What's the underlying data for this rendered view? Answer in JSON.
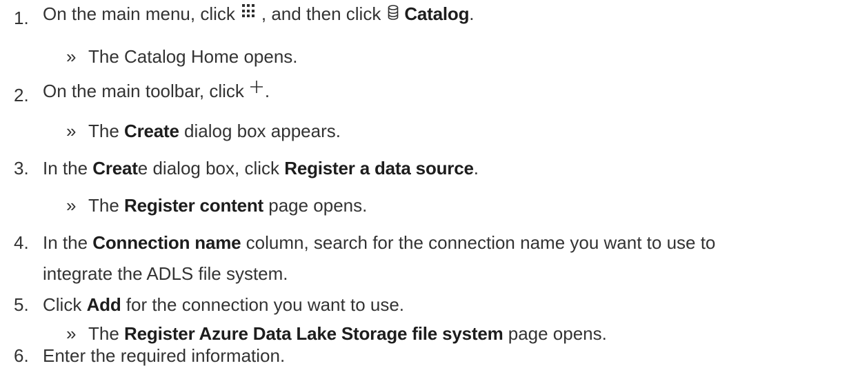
{
  "steps": [
    {
      "number": "1.",
      "parts": [
        "On the main menu, click",
        ", and then click",
        "Catalog",
        "."
      ],
      "icons": [
        "apps-grid-icon",
        "database-icon"
      ],
      "result": "The Catalog Home opens."
    },
    {
      "number": "2.",
      "parts": [
        "On the main toolbar, click",
        "."
      ],
      "icons": [
        "plus-icon"
      ],
      "result_parts": [
        "The",
        "Create",
        "dialog box appears."
      ]
    },
    {
      "number": "3.",
      "parts": [
        "In the",
        "Creat",
        "e dialog box, click",
        "Register a data source",
        "."
      ],
      "result_parts": [
        "The",
        "Register content",
        "page opens."
      ]
    },
    {
      "number": "4.",
      "parts": [
        "In the",
        "Connection name",
        "column, search for the connection name you want to use to"
      ],
      "continuation": "integrate the ADLS file system."
    },
    {
      "number": "5.",
      "parts": [
        "Click",
        "Add",
        "for the connection you want to use."
      ],
      "result_parts": [
        "The",
        "Register Azure Data Lake Storage file system",
        "page opens."
      ]
    },
    {
      "number": "6.",
      "parts": [
        "Enter the required information."
      ]
    }
  ],
  "result_marker": "»"
}
